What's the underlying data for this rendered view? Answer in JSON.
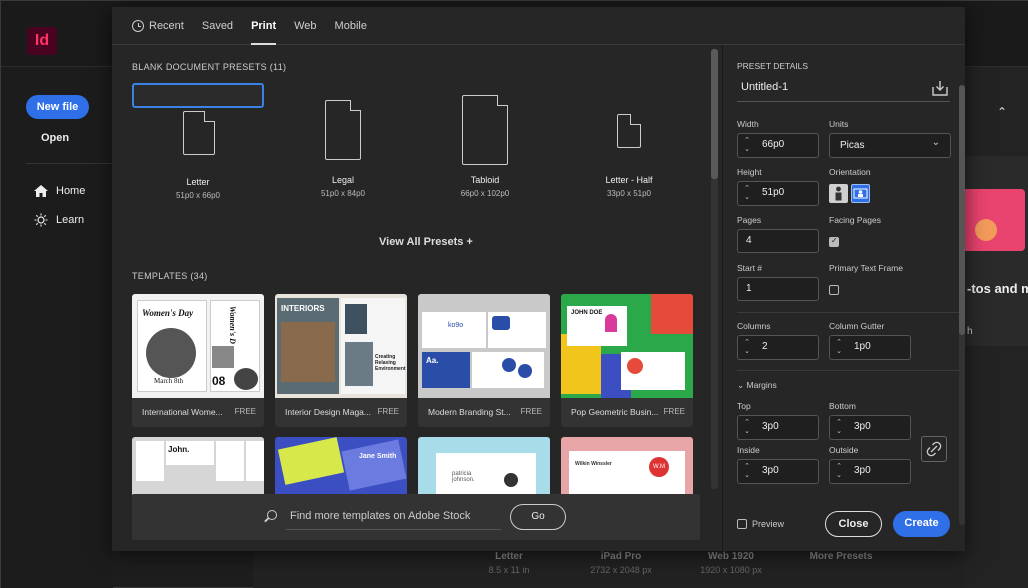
{
  "app": {
    "logo": "Id"
  },
  "home": {
    "new_file": "New file",
    "open": "Open",
    "nav": [
      {
        "label": "Home",
        "icon": "home-icon"
      },
      {
        "label": "Learn",
        "icon": "bulb-icon"
      }
    ],
    "bg_text": "-tos and m",
    "bg_h": "h",
    "bottom_presets": [
      {
        "name": "Letter",
        "dims": "8.5 x 11 in"
      },
      {
        "name": "iPad Pro",
        "dims": "2732 x 2048 px"
      },
      {
        "name": "Web 1920",
        "dims": "1920 x 1080 px"
      },
      {
        "name": "More Presets",
        "dims": ""
      }
    ]
  },
  "tabs": [
    "Recent",
    "Saved",
    "Print",
    "Web",
    "Mobile"
  ],
  "active_tab": "Print",
  "presets_header": "BLANK DOCUMENT PRESETS  (11)",
  "presets": [
    {
      "name": "Letter",
      "size": "51p0 x 66p0",
      "selected": true
    },
    {
      "name": "Legal",
      "size": "51p0 x 84p0",
      "selected": false
    },
    {
      "name": "Tabloid",
      "size": "66p0 x 102p0",
      "selected": false
    },
    {
      "name": "Letter - Half",
      "size": "33p0 x 51p0",
      "selected": false
    }
  ],
  "view_all": "View All Presets +",
  "templates_header": "TEMPLATES  (34)",
  "templates": [
    {
      "name": "International Wome...",
      "badge": "FREE",
      "thumb_text": [
        "Women's Day",
        "March 8th",
        "Women's D",
        "08"
      ]
    },
    {
      "name": "Interior Design Maga...",
      "badge": "FREE",
      "thumb_text": [
        "INTERIORS",
        "Creating Relaxing Environment"
      ]
    },
    {
      "name": "Modern Branding St...",
      "badge": "FREE",
      "thumb_text": [
        "ko9o",
        "Aa."
      ]
    },
    {
      "name": "Pop Geometric Busin...",
      "badge": "FREE",
      "thumb_text": [
        "JOHN DOE"
      ]
    }
  ],
  "templates_row2": [
    {
      "thumb_text": "John."
    },
    {
      "thumb_text": "Jane Smith"
    },
    {
      "thumb_text": "patricia johnson."
    },
    {
      "thumb_text": "Wilkin Winssler",
      "badge": "W.M"
    }
  ],
  "stock": {
    "placeholder": "Find more templates on Adobe Stock",
    "go": "Go"
  },
  "panel": {
    "header": "PRESET DETAILS",
    "doc_name": "Untitled-1",
    "width_label": "Width",
    "width": "66p0",
    "units_label": "Units",
    "units": "Picas",
    "height_label": "Height",
    "height": "51p0",
    "orientation_label": "Orientation",
    "pages_label": "Pages",
    "pages": "4",
    "facing_label": "Facing Pages",
    "facing": true,
    "start_label": "Start #",
    "start": "1",
    "ptf_label": "Primary Text Frame",
    "ptf": false,
    "columns_label": "Columns",
    "columns": "2",
    "gutter_label": "Column Gutter",
    "gutter": "1p0",
    "margins_label": "Margins",
    "top_label": "Top",
    "top": "3p0",
    "bottom_label": "Bottom",
    "bottom": "3p0",
    "inside_label": "Inside",
    "inside": "3p0",
    "outside_label": "Outside",
    "outside": "3p0",
    "preview_label": "Preview",
    "close": "Close",
    "create": "Create"
  },
  "colors": {
    "accent": "#2f6fe8",
    "selection": "#3b82e6"
  }
}
